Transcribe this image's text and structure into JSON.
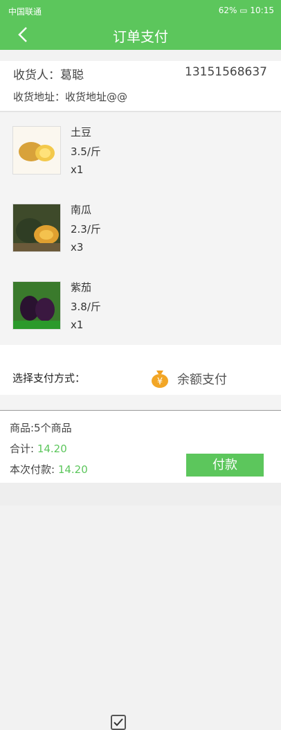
{
  "status_bar": {
    "carrier": "中国联通",
    "battery": "62%",
    "time": "10:15"
  },
  "header": {
    "title": "订单支付"
  },
  "address": {
    "name_label": "收货人：葛聪",
    "phone": "13151568637",
    "address_label": "收货地址：收货地址@@"
  },
  "items": [
    {
      "name": "土豆",
      "price": "3.5/斤",
      "qty": "x1"
    },
    {
      "name": "南瓜",
      "price": "2.3/斤",
      "qty": "x3"
    },
    {
      "name": "紫茄",
      "price": "3.8/斤",
      "qty": "x1"
    }
  ],
  "payment": {
    "label": "选择支付方式：",
    "method": "余额支付"
  },
  "summary": {
    "goods": "商品:5个商品",
    "total_label": "合计: ",
    "total_value": "14.20",
    "pay_label": "本次付款: ",
    "pay_value": "14.20",
    "pay_button": "付款"
  },
  "colors": {
    "accent": "#5cc65c"
  }
}
